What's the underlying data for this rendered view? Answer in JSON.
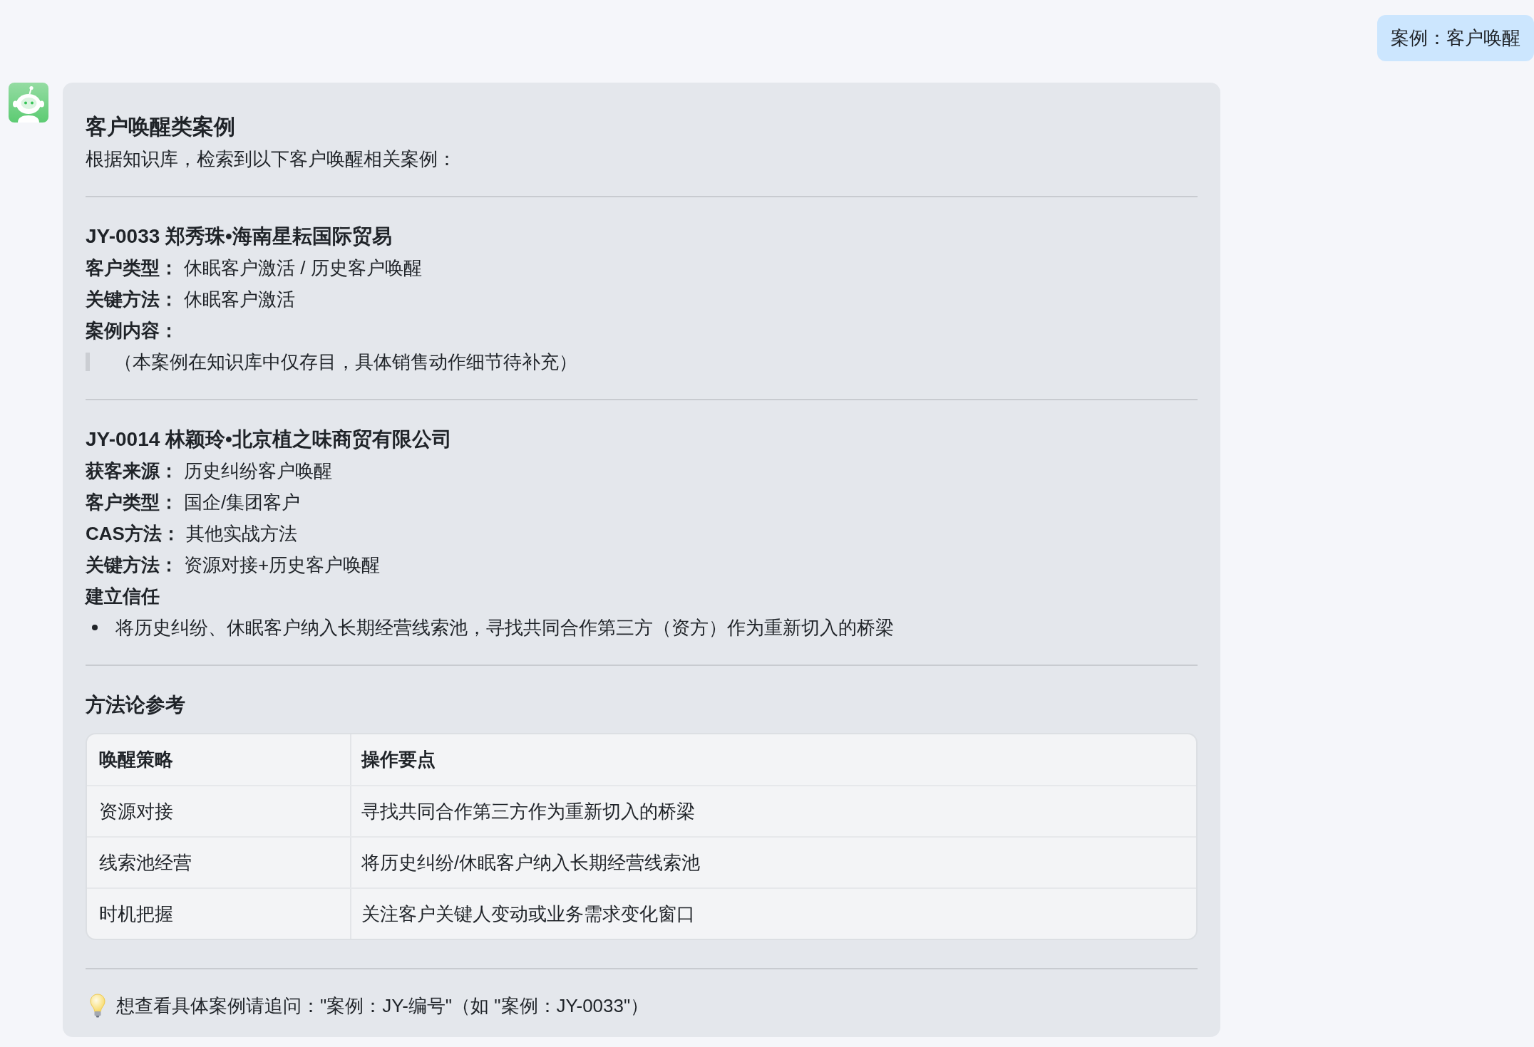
{
  "user_message": {
    "text": "案例：客户唤醒"
  },
  "reply": {
    "title": "客户唤醒类案例",
    "intro": "根据知识库，检索到以下客户唤醒相关案例：",
    "cases": [
      {
        "heading": "JY-0033 郑秀珠•海南星耘国际贸易",
        "blocks": [
          {
            "kind": "field",
            "label": "客户类型：",
            "value": "休眠客户激活 / 历史客户唤醒"
          },
          {
            "kind": "field",
            "label": "关键方法：",
            "value": "休眠客户激活"
          },
          {
            "kind": "label",
            "label": "案例内容："
          },
          {
            "kind": "quote",
            "text": "（本案例在知识库中仅存目，具体销售动作细节待补充）"
          }
        ]
      },
      {
        "heading": "JY-0014 林颖玲•北京植之味商贸有限公司",
        "blocks": [
          {
            "kind": "field",
            "label": "获客来源：",
            "value": "历史纠纷客户唤醒"
          },
          {
            "kind": "field",
            "label": "客户类型：",
            "value": "国企/集团客户"
          },
          {
            "kind": "field",
            "label": "CAS方法：",
            "value": "其他实战方法"
          },
          {
            "kind": "field",
            "label": "关键方法：",
            "value": "资源对接+历史客户唤醒"
          },
          {
            "kind": "label",
            "label": "建立信任"
          },
          {
            "kind": "bullet",
            "text": "将历史纠纷、休眠客户纳入长期经营线索池，寻找共同合作第三方（资方）作为重新切入的桥梁"
          }
        ]
      }
    ],
    "methodology": {
      "title": "方法论参考",
      "table": {
        "columns": [
          "唤醒策略",
          "操作要点"
        ],
        "rows": [
          [
            "资源对接",
            "寻找共同合作第三方作为重新切入的桥梁"
          ],
          [
            "线索池经营",
            "将历史纠纷/休眠客户纳入长期经营线索池"
          ],
          [
            "时机把握",
            "关注客户关键人变动或业务需求变化窗口"
          ]
        ]
      }
    },
    "tip": "想查看具体案例请追问：\"案例：JY-编号\"（如 \"案例：JY-0033\"）"
  }
}
